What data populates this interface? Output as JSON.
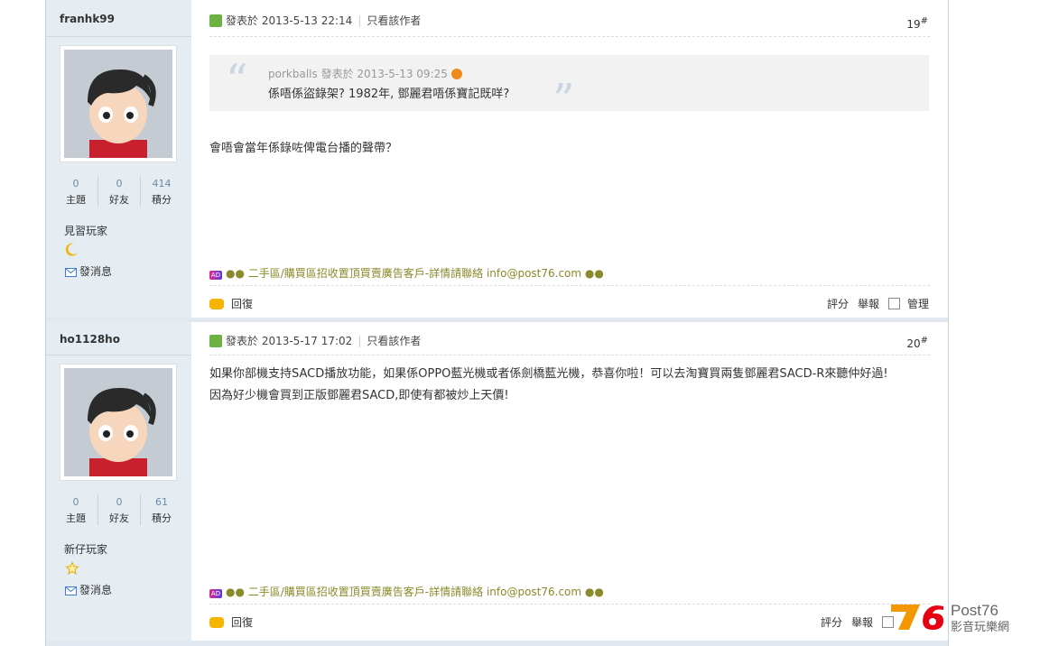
{
  "posts": [
    {
      "username": "franhk99",
      "stats": [
        {
          "value": "0",
          "label": "主題"
        },
        {
          "value": "0",
          "label": "好友"
        },
        {
          "value": "414",
          "label": "積分"
        }
      ],
      "rank": "見習玩家",
      "rank_icon": "moon-icon",
      "pm_label": "發消息",
      "posted_at": "發表於 2013-5-13 22:14",
      "author_only": "只看該作者",
      "floor": "19",
      "floor_mark": "#",
      "quote": {
        "author": "porkballs",
        "posted_at": "發表於 2013-5-13 09:25",
        "text": "係唔係盜錄架? 1982年, 鄧麗君唔係寶記既咩?"
      },
      "body": [
        "會唔會當年係錄咗俾電台播的聲帶？"
      ],
      "ad_text": "●● 二手區/購買區招收置頂買賣廣告客戶-詳情請聯絡 info@post76.com ●●",
      "reply_label": "回復",
      "tools": [
        "評分",
        "舉報",
        "管理"
      ]
    },
    {
      "username": "ho1128ho",
      "stats": [
        {
          "value": "0",
          "label": "主題"
        },
        {
          "value": "0",
          "label": "好友"
        },
        {
          "value": "61",
          "label": "積分"
        }
      ],
      "rank": "新仔玩家",
      "rank_icon": "star-icon",
      "pm_label": "發消息",
      "posted_at": "發表於 2013-5-17 17:02",
      "author_only": "只看該作者",
      "floor": "20",
      "floor_mark": "#",
      "body": [
        "如果你部機支持SACD播放功能，如果係OPPO藍光機或者係劍橋藍光機，恭喜你啦！可以去淘寶買兩隻鄧麗君SACD-R來聽仲好過!",
        "因為好少機會買到正版鄧麗君SACD,即使有都被炒上天價!"
      ],
      "ad_text": "●● 二手區/購買區招收置頂買賣廣告客戶-詳情請聯絡 info@post76.com ●●",
      "reply_label": "回復",
      "tools": [
        "評分",
        "舉報"
      ]
    }
  ],
  "logo": {
    "brand": "Post76",
    "number": "76",
    "tagline": "影音玩樂網"
  },
  "colors": {
    "sidebar": "#e5edf2",
    "accent_green": "#6cb142",
    "ad_text": "#8a8a2c",
    "logo_orange": "#f39800"
  }
}
